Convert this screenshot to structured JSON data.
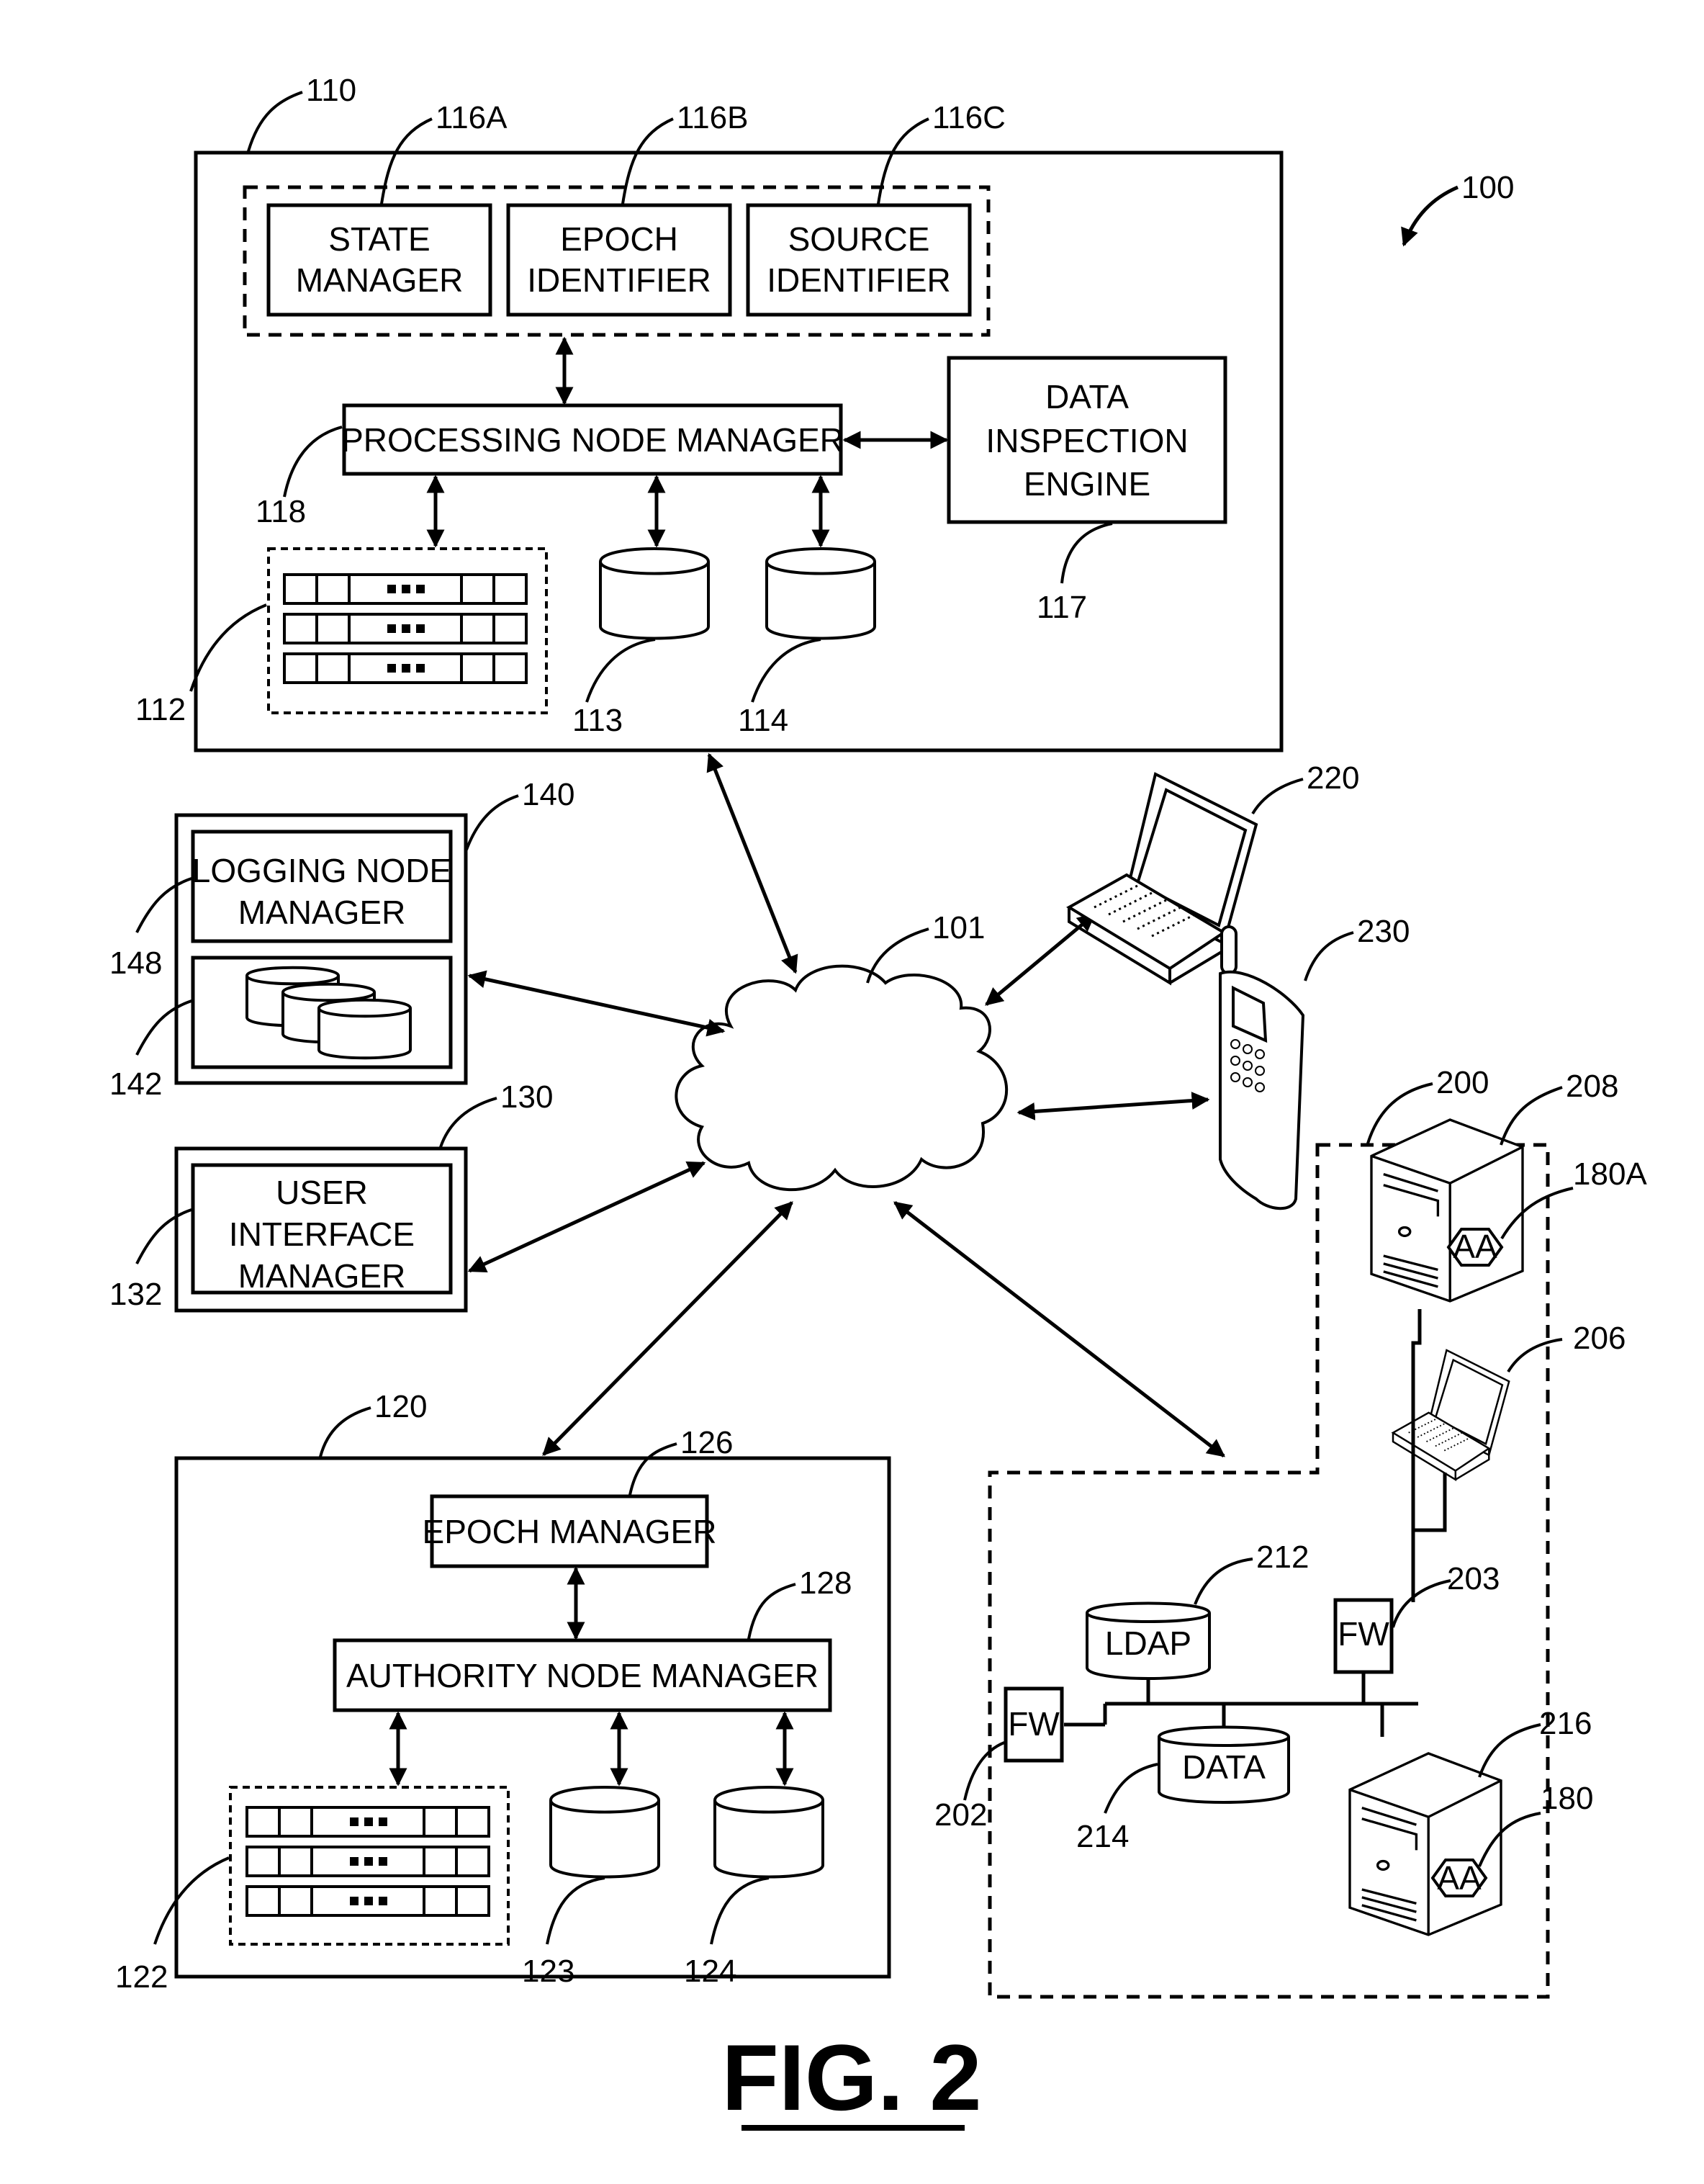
{
  "figure": {
    "title": "FIG. 2",
    "system_ref": "100"
  },
  "processing_node": {
    "ref": "110",
    "group": [
      {
        "ref": "116A",
        "lines": [
          "STATE",
          "MANAGER"
        ]
      },
      {
        "ref": "116B",
        "lines": [
          "EPOCH",
          "IDENTIFIER"
        ]
      },
      {
        "ref": "116C",
        "lines": [
          "SOURCE",
          "IDENTIFIER"
        ]
      }
    ],
    "manager": {
      "ref": "118",
      "label": "PROCESSING NODE MANAGER"
    },
    "inspection": {
      "ref": "117",
      "lines": [
        "DATA",
        "INSPECTION",
        "ENGINE"
      ]
    },
    "servers_ref": "112",
    "db1_ref": "113",
    "db2_ref": "114"
  },
  "logging_node": {
    "ref": "140",
    "manager": {
      "ref": "148",
      "lines": [
        "LOGGING NODE",
        "MANAGER"
      ]
    },
    "storage_ref": "142"
  },
  "ui_node": {
    "ref": "130",
    "manager": {
      "ref": "132",
      "lines": [
        "USER",
        "INTERFACE",
        "MANAGER"
      ]
    }
  },
  "authority_node": {
    "ref": "120",
    "epoch_manager": {
      "ref": "126",
      "label": "EPOCH MANAGER"
    },
    "manager": {
      "ref": "128",
      "label": "AUTHORITY NODE MANAGER"
    },
    "servers_ref": "122",
    "db1_ref": "123",
    "db2_ref": "124"
  },
  "network": {
    "ref": "101"
  },
  "laptop": {
    "ref": "220"
  },
  "phone": {
    "ref": "230"
  },
  "enterprise": {
    "ref": "200",
    "server_top": {
      "ref": "208",
      "agent_ref": "180A",
      "agent_label": "AA"
    },
    "laptop_ref": "206",
    "fw_inner": {
      "ref": "203",
      "label": "FW"
    },
    "fw_outer": {
      "ref": "202",
      "label": "FW"
    },
    "ldap": {
      "ref": "212",
      "label": "LDAP"
    },
    "data": {
      "ref": "214",
      "label": "DATA"
    },
    "server_bottom": {
      "ref": "216",
      "agent_ref": "180",
      "agent_label": "AA"
    }
  }
}
